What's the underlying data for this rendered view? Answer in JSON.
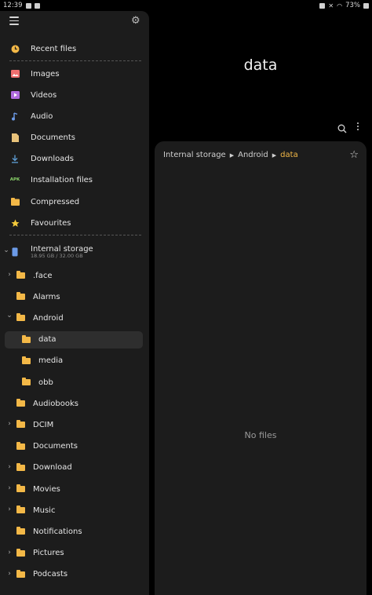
{
  "status_bar": {
    "time": "12:39",
    "battery": "73%"
  },
  "sidebar": {
    "nav": [
      {
        "label": "Recent files",
        "icon": "clock-icon",
        "color": "#f3b847"
      },
      {
        "label": "Images",
        "icon": "image-icon",
        "color": "#f06f6f"
      },
      {
        "label": "Videos",
        "icon": "video-icon",
        "color": "#b06be0"
      },
      {
        "label": "Audio",
        "icon": "music-note-icon",
        "color": "#6c9be8"
      },
      {
        "label": "Documents",
        "icon": "document-icon",
        "color": "#e8c27a"
      },
      {
        "label": "Downloads",
        "icon": "download-icon",
        "color": "#5fa0d8"
      },
      {
        "label": "Installation files",
        "icon": "apk-icon",
        "color": "#8bd46a",
        "badge": "APK"
      },
      {
        "label": "Compressed",
        "icon": "archive-icon",
        "color": "#f3b847"
      },
      {
        "label": "Favourites",
        "icon": "star-icon",
        "color": "#f3c93b"
      }
    ],
    "storage": {
      "label": "Internal storage",
      "usage": "18.95 GB / 32.00 GB"
    },
    "tree": [
      {
        "label": ".face",
        "chevron": ">",
        "indent": 0
      },
      {
        "label": "Alarms",
        "chevron": "",
        "indent": 0
      },
      {
        "label": "Android",
        "chevron": "v",
        "indent": 0
      },
      {
        "label": "data",
        "chevron": "",
        "indent": 1,
        "selected": true
      },
      {
        "label": "media",
        "chevron": "",
        "indent": 1
      },
      {
        "label": "obb",
        "chevron": "",
        "indent": 1
      },
      {
        "label": "Audiobooks",
        "chevron": "",
        "indent": 0
      },
      {
        "label": "DCIM",
        "chevron": ">",
        "indent": 0
      },
      {
        "label": "Documents",
        "chevron": "",
        "indent": 0
      },
      {
        "label": "Download",
        "chevron": ">",
        "indent": 0
      },
      {
        "label": "Movies",
        "chevron": ">",
        "indent": 0
      },
      {
        "label": "Music",
        "chevron": ">",
        "indent": 0
      },
      {
        "label": "Notifications",
        "chevron": "",
        "indent": 0
      },
      {
        "label": "Pictures",
        "chevron": ">",
        "indent": 0
      },
      {
        "label": "Podcasts",
        "chevron": ">",
        "indent": 0
      }
    ]
  },
  "main": {
    "title": "data",
    "breadcrumb": [
      "Internal storage",
      "Android",
      "data"
    ],
    "empty_text": "No files"
  }
}
